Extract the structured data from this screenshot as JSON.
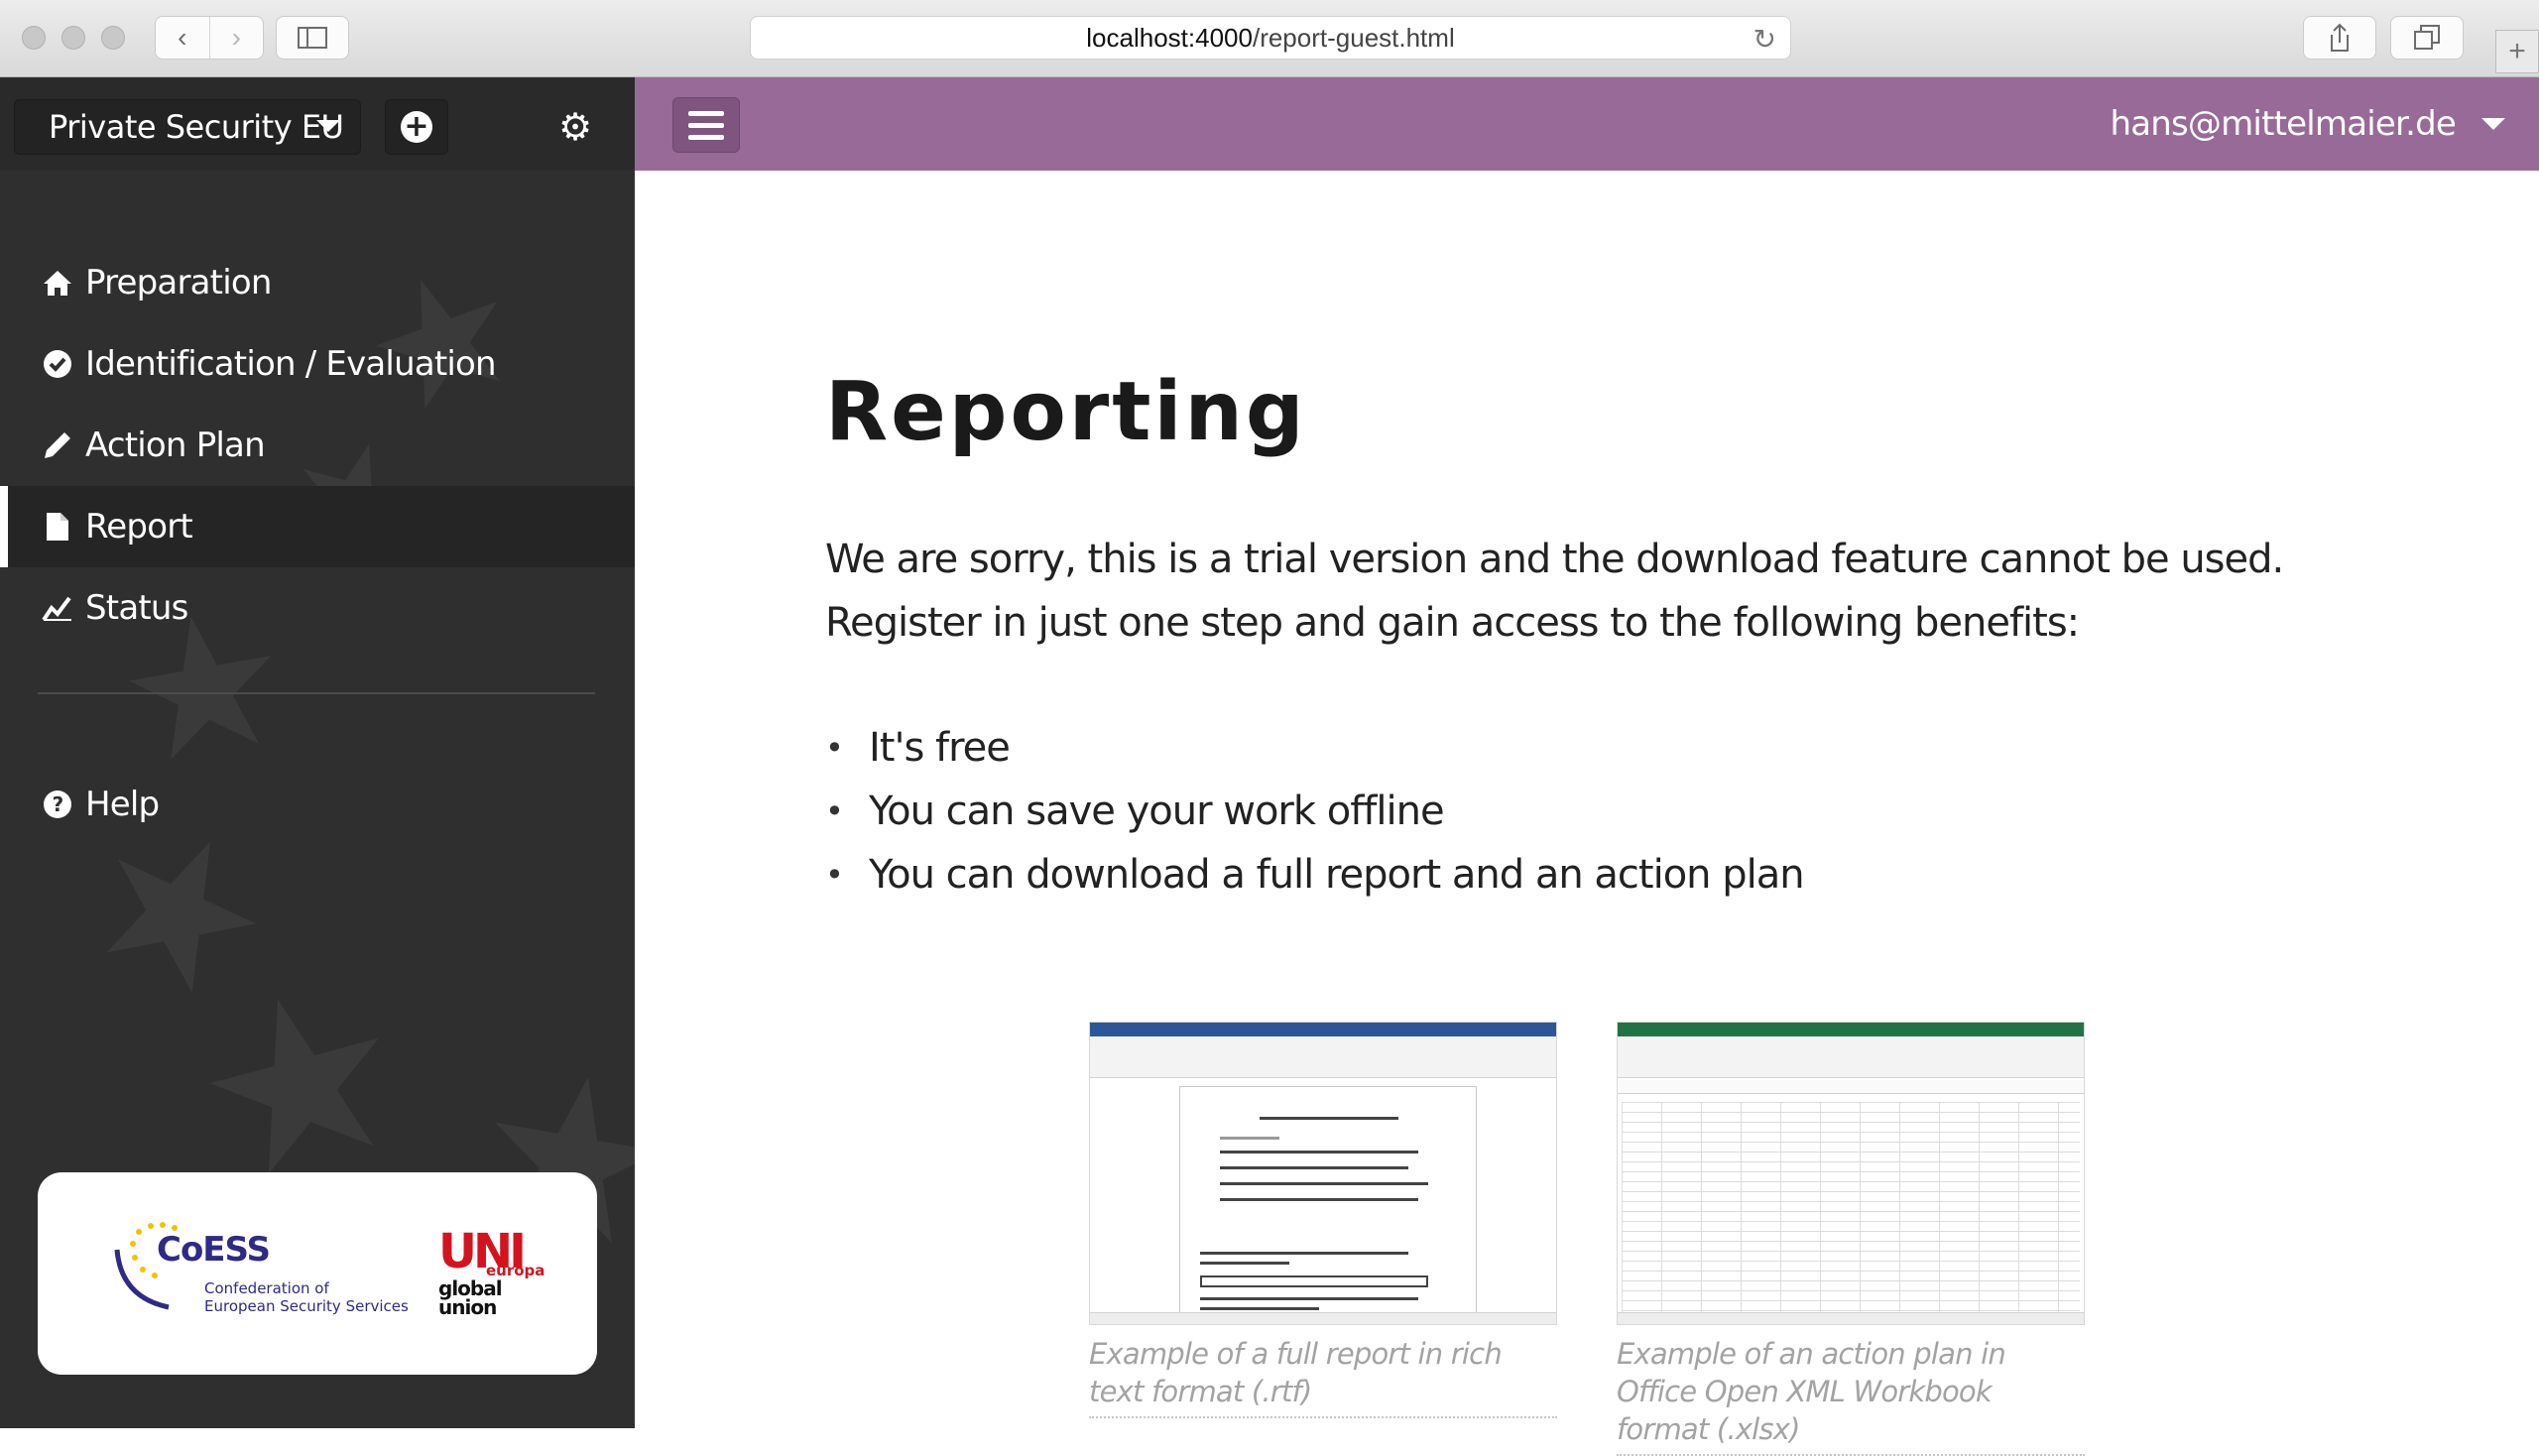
{
  "browser": {
    "url_host": "localhost:4000",
    "url_path": "/report-guest.html"
  },
  "sidebar": {
    "org_name": "Private Security EU",
    "nav": [
      {
        "label": "Preparation",
        "icon": "home-icon"
      },
      {
        "label": "Identification / Evaluation",
        "icon": "check-circle-icon"
      },
      {
        "label": "Action Plan",
        "icon": "pencil-icon"
      },
      {
        "label": "Report",
        "icon": "file-icon",
        "active": true
      },
      {
        "label": "Status",
        "icon": "chart-line-icon"
      }
    ],
    "help_label": "Help",
    "logos": {
      "coess_title": "CoESS",
      "coess_sub_1": "Confederation of",
      "coess_sub_2": "European Security Services",
      "uni_mark": "UNI",
      "uni_europa": "europa",
      "uni_global_1": "global",
      "uni_global_2": "union"
    }
  },
  "topbar": {
    "user_email": "hans@mittelmaier.de"
  },
  "main": {
    "title": "Reporting",
    "intro": "We are sorry, this is a trial version and the download feature cannot be used. Register in just one step and gain access to the following benefits:",
    "benefits": [
      "It's free",
      "You can save your work offline",
      "You can download a full report and an action plan"
    ],
    "examples": [
      {
        "caption": "Example of a full report in rich text format (.rtf)"
      },
      {
        "caption": "Example of an action plan in Office Open XML Workbook format (.xlsx)"
      }
    ]
  },
  "colors": {
    "accent": "#986a98",
    "sidebar": "#2f2f2f",
    "word_blue": "#2b579a",
    "excel_green": "#217346"
  }
}
